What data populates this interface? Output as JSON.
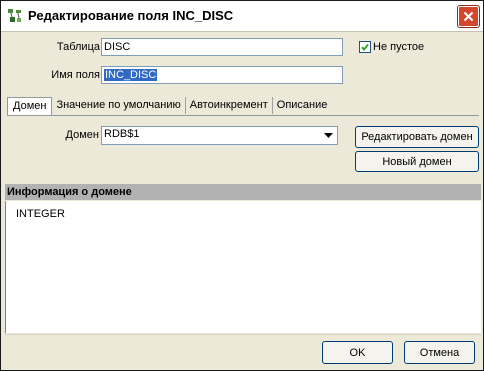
{
  "window": {
    "title": "Редактирование поля INC_DISC"
  },
  "form": {
    "table_label": "Таблица",
    "table_value": "DISC",
    "field_name_label": "Имя поля",
    "field_name_value": "INC_DISC",
    "not_null_label": "Не пустое",
    "not_null_checked": true
  },
  "tabs": [
    {
      "label": "Домен",
      "active": true
    },
    {
      "label": "Значение по умолчанию",
      "active": false
    },
    {
      "label": "Автоинкремент",
      "active": false
    },
    {
      "label": "Описание",
      "active": false
    }
  ],
  "domain_tab": {
    "domain_label": "Домен",
    "domain_value": "RDB$1",
    "edit_domain_button": "Редактировать домен",
    "new_domain_button": "Новый домен"
  },
  "info": {
    "header": "Информация о домене",
    "content": "INTEGER"
  },
  "footer": {
    "ok_button": "OK",
    "cancel_button": "Отмена"
  },
  "colors": {
    "selection": "#316ac5",
    "close_button": "#d2482e",
    "info_header": "#b2b2b2"
  }
}
